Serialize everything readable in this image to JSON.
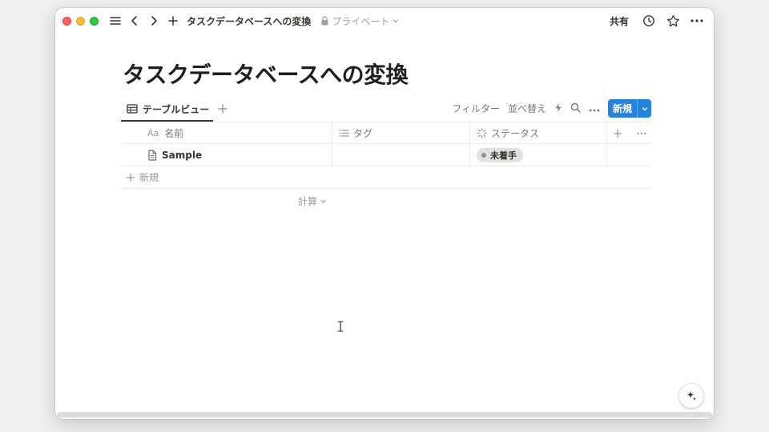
{
  "header": {
    "title": "タスクデータベースへの変換",
    "privacy": "プライベート",
    "share_label": "共有"
  },
  "page": {
    "title": "タスクデータベースへの変換"
  },
  "view": {
    "tab_label": "テーブルビュー",
    "filter_label": "フィルター",
    "sort_label": "並べ替え",
    "new_label": "新規"
  },
  "table": {
    "columns": [
      {
        "icon": "Aa",
        "label": "名前"
      },
      {
        "icon": "list-icon",
        "label": "タグ"
      },
      {
        "icon": "status-icon",
        "label": "ステータス"
      }
    ],
    "rows": [
      {
        "name": "Sample",
        "tag": "",
        "status": "未着手"
      }
    ],
    "new_row_label": "新規",
    "calc_label": "計算"
  },
  "colors": {
    "accent": "#2383e2",
    "status_pill_bg": "#e3e2e0"
  }
}
